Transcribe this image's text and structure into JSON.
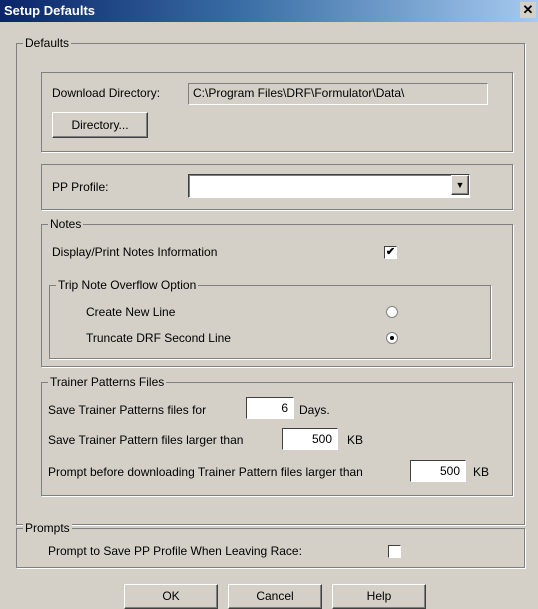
{
  "window": {
    "title": "Setup Defaults",
    "close_glyph": "✕"
  },
  "defaults": {
    "group_label": "Defaults",
    "download_dir_label": "Download Directory:",
    "download_dir_value": "C:\\Program Files\\DRF\\Formulator\\Data\\",
    "directory_button": "Directory..."
  },
  "pp_profile": {
    "label": "PP Profile:",
    "value": "",
    "arrow": "▼"
  },
  "notes": {
    "group_label": "Notes",
    "display_label": "Display/Print Notes Information",
    "display_checked": true,
    "overflow_group_label": "Trip Note Overflow Option",
    "create_new_line_label": "Create New Line",
    "create_new_line_selected": false,
    "truncate_label": "Truncate DRF Second Line",
    "truncate_selected": true
  },
  "trainer": {
    "group_label": "Trainer Patterns Files",
    "save_for_label": "Save Trainer Patterns files for",
    "save_for_value": "6",
    "save_for_unit": "Days.",
    "larger_than_label": "Save Trainer Pattern files larger than",
    "larger_than_value": "500",
    "larger_than_unit": "KB",
    "prompt_label": "Prompt before downloading Trainer Pattern files larger than",
    "prompt_value": "500",
    "prompt_unit": "KB"
  },
  "prompts": {
    "group_label": "Prompts",
    "save_pp_label": "Prompt to Save PP Profile When Leaving Race:",
    "save_pp_checked": false
  },
  "buttons": {
    "ok": "OK",
    "cancel": "Cancel",
    "help": "Help"
  },
  "icons": {
    "checkmark": "✔"
  }
}
